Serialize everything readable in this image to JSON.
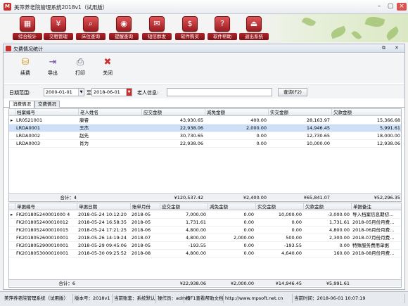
{
  "window": {
    "title": "美萍养老院管理系统2018v1（试用版）",
    "logo": "M"
  },
  "toolbar": [
    {
      "label": "综合统计",
      "icon": "chart-icon",
      "glyph": "▦"
    },
    {
      "label": "交租管理",
      "icon": "money-icon",
      "glyph": "¥"
    },
    {
      "label": "床位查询",
      "icon": "bed-search-icon",
      "glyph": "⌕"
    },
    {
      "label": "提醒查询",
      "icon": "reminder-icon",
      "glyph": "◉"
    },
    {
      "label": "短信群发",
      "icon": "sms-icon",
      "glyph": "✉"
    },
    {
      "label": "软件购买",
      "icon": "buy-icon",
      "glyph": "$"
    },
    {
      "label": "软件帮助",
      "icon": "help-icon",
      "glyph": "?"
    },
    {
      "label": "退出系统",
      "icon": "exit-icon",
      "glyph": "⏏"
    }
  ],
  "child_window": {
    "title": "欠费情况统计"
  },
  "child_tools": [
    {
      "label": "续费",
      "icon": "renew-icon",
      "glyph": "⛁"
    },
    {
      "label": "导出",
      "icon": "export-icon",
      "glyph": "⇥"
    },
    {
      "label": "打印",
      "icon": "printer-icon",
      "glyph": "⎙"
    },
    {
      "label": "关闭",
      "icon": "close-icon",
      "glyph": "✖"
    }
  ],
  "filter": {
    "date_label": "日期范围:",
    "date_from": "2000-01-01",
    "to_label": "至",
    "date_to": "2018-06-01",
    "elder_label": "老人信息:",
    "elder_value": "",
    "query_button": "查询(F2)"
  },
  "tabs": [
    "消费情况",
    "交费情况"
  ],
  "top_grid": {
    "columns": [
      "档案编号",
      "老人姓名",
      "应交金额",
      "减免金额",
      "实交金额",
      "欠款金额"
    ],
    "rows": [
      [
        "LR0521001",
        "康睿",
        "43,930.65",
        "400.00",
        "28,163.97",
        "15,366.68"
      ],
      [
        "LRDA0001",
        "王杰",
        "22,938.06",
        "2,000.00",
        "14,946.45",
        "5,991.61"
      ],
      [
        "LRDA0002",
        "赵先",
        "30,730.65",
        "0.00",
        "12,730.65",
        "18,000.00"
      ],
      [
        "LRDA0003",
        "肖为",
        "22,938.06",
        "0.00",
        "10,000.00",
        "12,938.06"
      ]
    ],
    "footer": [
      "合计：4",
      "",
      "¥120,537.42",
      "¥2,400.00",
      "¥65,841.07",
      "¥52,296.35"
    ]
  },
  "bottom_grid": {
    "columns": [
      "单据编号",
      "单据日期",
      "账单月份",
      "应交金额",
      "减免金额",
      "实交金额",
      "欠款金额",
      "单据备注"
    ],
    "rows": [
      [
        "FK201805240001000 4",
        "2018-05-24 10:12:20",
        "2018-05",
        "7,000.00",
        "0.00",
        "10,000.00",
        "-3,000.00",
        "导入档案信息期初..."
      ],
      [
        "FK2018052400010012",
        "2018-05-24 16:58:35",
        "2018-05",
        "1,731.61",
        "0.00",
        "0.00",
        "1,731.61",
        "2018-05月份月费..."
      ],
      [
        "FK2018052400010015",
        "2018-05-24 17:21:25",
        "2018-06",
        "4,800.00",
        "0.00",
        "0.00",
        "4,800.00",
        "2018-06月份月费..."
      ],
      [
        "FK2018052600010001",
        "2018-05-26 14:19:24",
        "2018-07",
        "4,800.00",
        "2,000.00",
        "500.00",
        "2,300.00",
        "2018-07月份月费..."
      ],
      [
        "FK2018052900010001",
        "2018-05-29 09:45:06",
        "2018-05",
        "-193.55",
        "0.00",
        "-193.55",
        "0.00",
        "特殊服务费用单据"
      ],
      [
        "FK2018053000010001",
        "2018-05-30 09:25:52",
        "2018-08",
        "4,800.00",
        "0.00",
        "4,640.00",
        "160.00",
        "2018-08月份月费..."
      ]
    ],
    "footer": [
      "合计：6",
      "",
      "",
      "¥22,938.06",
      "¥2,000.00",
      "¥14,946.45",
      "¥5,991.61",
      ""
    ]
  },
  "statusbar": [
    "美萍养老院管理系统（试用版）",
    "版本号：2018v1",
    "当前账套：系统默认",
    "操作员：admin",
    "按F1查看帮助文档",
    "http://www.mpsoft.net.cn",
    "当前时间：2018-06-01 10:07:19"
  ]
}
